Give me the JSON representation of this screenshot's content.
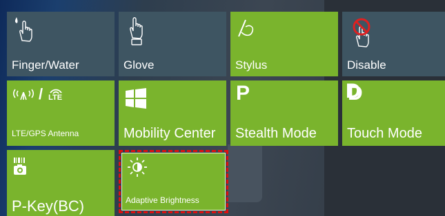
{
  "tiles": {
    "finger_water": {
      "label": "Finger/Water",
      "icon": "finger-water-icon"
    },
    "glove": {
      "label": "Glove",
      "icon": "glove-hand-icon"
    },
    "stylus": {
      "label": "Stylus",
      "icon": "stylus-icon"
    },
    "disable": {
      "label": "Disable",
      "icon": "touch-disabled-icon"
    },
    "lte_gps": {
      "label": "LTE/GPS Antenna",
      "icon_text": "/",
      "icon_lte": "LTE"
    },
    "mobility": {
      "label": "Mobility Center",
      "icon": "windows-logo-icon"
    },
    "stealth": {
      "label": "Stealth Mode",
      "glyph": "P"
    },
    "touch": {
      "label": "Touch Mode",
      "glyph": "D"
    },
    "pkey": {
      "label": "P-Key(BC)",
      "icon": "barcode-camera-icon"
    },
    "adaptive": {
      "label": "Adaptive Brightness",
      "icon": "sun-icon"
    }
  },
  "colors": {
    "slate_tile": "#3e5562",
    "green_tile": "#7ab42d",
    "focus_border": "#e01010",
    "disable_mark": "#e02020"
  }
}
